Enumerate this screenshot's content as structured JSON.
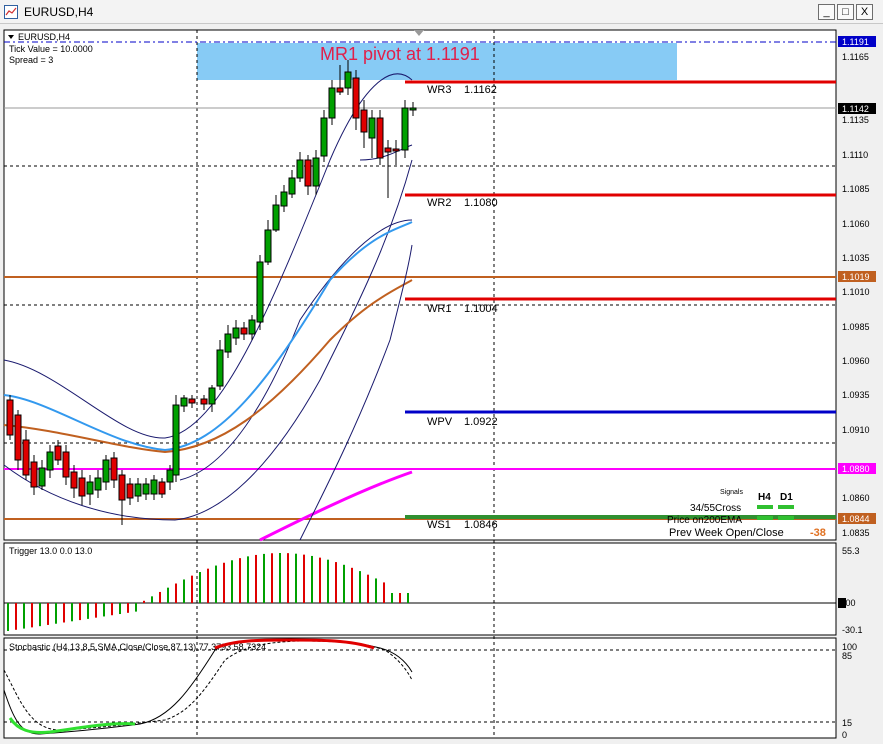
{
  "window": {
    "title": "EURUSD,H4",
    "minimize_label": "_",
    "maximize_label": "□",
    "close_label": "X"
  },
  "main_panel": {
    "symbol_label": "EURUSD,H4",
    "tick_value": "Tick Value = 10.0000",
    "spread": "Spread = 3",
    "price_ticks": [
      "1.1191",
      "1.1165",
      "1.1142",
      "1.1135",
      "1.1110",
      "1.1085",
      "1.1060",
      "1.1035",
      "1.1019",
      "1.1010",
      "1.0985",
      "1.0960",
      "1.0935",
      "1.0910",
      "1.0880",
      "1.0860",
      "1.0844",
      "1.0835"
    ],
    "banner_text": "MR1 pivot at 1.1191",
    "levels": [
      {
        "label": "WR3",
        "value": "1.1162",
        "color": "#e00000"
      },
      {
        "label": "WR2",
        "value": "1.1080",
        "color": "#e00000"
      },
      {
        "label": "WR1",
        "value": "1.1004",
        "color": "#e00000"
      },
      {
        "label": "WPV",
        "value": "1.0922",
        "color": "#0000c8"
      },
      {
        "label": "WS1",
        "value": "1.0846",
        "color": "#00a000"
      }
    ],
    "signals": {
      "title": "Signals",
      "col_h4": "H4",
      "col_d1": "D1",
      "row1": "34/55Cross",
      "row2": "Price on200EMA",
      "row3": "Prev Week Open/Close",
      "row3_value": "-38"
    }
  },
  "trigger_panel": {
    "label": "Trigger 13.0 0.0 13.0",
    "ticks": [
      "55.3",
      "0.00",
      "-30.1"
    ]
  },
  "stoch_panel": {
    "label": "Stochastic (H4,13,8,5,SMA,Close/Close,87,13) 77.3793 58.7324",
    "ticks": [
      "100",
      "85",
      "15",
      "0"
    ]
  },
  "colors": {
    "bull": "#00a000",
    "bear": "#e00000",
    "ema_blue": "#3399ee",
    "ema_brown": "#c06020",
    "magenta": "#ff00ff",
    "banner": "#87cbf5",
    "banner_text": "#e0204a"
  }
}
